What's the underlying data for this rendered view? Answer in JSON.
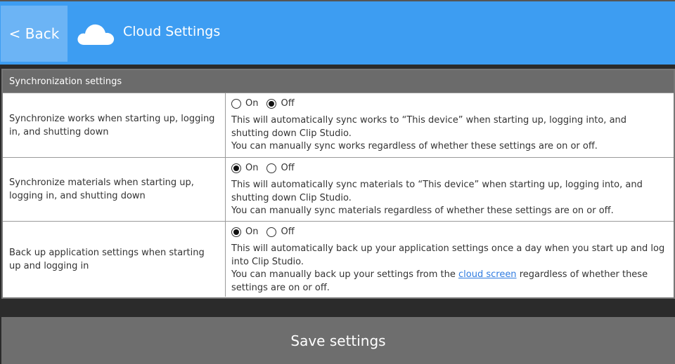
{
  "header": {
    "back_label": "< Back",
    "title": "Cloud Settings",
    "bg_color": "#3d9df2",
    "icon": "cloud-icon"
  },
  "panel": {
    "title": "Synchronization settings",
    "rows": [
      {
        "label": "Synchronize works when starting up, logging in, and shutting down",
        "on_label": "On",
        "off_label": "Off",
        "selected": "off",
        "desc1": "This will automatically sync works to “This device” when starting up, logging into, and shutting down Clip Studio.",
        "desc2": "You can manually sync works regardless of whether these settings are on or off."
      },
      {
        "label": "Synchronize materials when starting up, logging in, and shutting down",
        "on_label": "On",
        "off_label": "Off",
        "selected": "on",
        "desc1": "This will automatically sync materials to “This device” when starting up, logging into, and shutting down Clip Studio.",
        "desc2": "You can manually sync materials regardless of whether these settings are on or off."
      },
      {
        "label": "Back up application settings when starting up and logging in",
        "on_label": "On",
        "off_label": "Off",
        "selected": "on",
        "desc1": "This will automatically back up your application settings once a day when you start up and log into Clip Studio.",
        "desc2_pre": "You can manually back up your settings from the ",
        "desc2_link": "cloud screen",
        "desc2_post": " regardless of whether these settings are on or off."
      }
    ]
  },
  "footer": {
    "save_label": "Save settings"
  }
}
